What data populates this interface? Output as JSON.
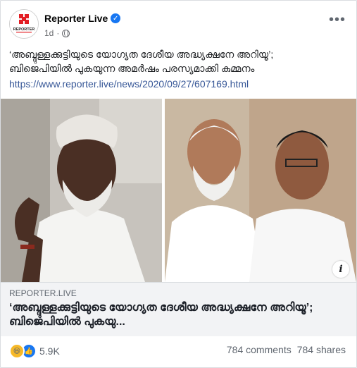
{
  "post": {
    "page_name": "Reporter Live",
    "verified_icon": "verified-badge-icon",
    "time": "1d",
    "privacy_icon": "globe-icon",
    "more_label": "•••",
    "text_line1": "‘അബ്ദുള്ളക്കുട്ടിയുടെ യോഗ്യത ദേശീയ അദ്ധ്യക്ഷനേ അറിയൂ’;",
    "text_line2": "ബിജെപിയിൽ പുകയുന്ന അമർഷം പരസ്യമാക്കി കുമ്മനം",
    "link": "https://www.reporter.live/news/2020/09/27/607169.html"
  },
  "avatar": {
    "brand_text": "REPORTER",
    "brand_color": "#e31e24"
  },
  "preview": {
    "domain": "REPORTER.LIVE",
    "title": "‘അബ്ദുള്ളക്കുട്ടിയുടെ യോഗ്യത ദേശീയ അദ്ധ്യക്ഷനേ അറിയൂ’; ബിജെപിയിൽ പുകയു...",
    "info_label": "i"
  },
  "stats": {
    "reactions_count": "5.9K",
    "comments": "784 comments",
    "shares": "784 shares",
    "reaction_icons": [
      "haha-icon",
      "like-icon"
    ]
  },
  "colors": {
    "link": "#385898",
    "accent": "#1877f2",
    "haha": "#f7b928"
  }
}
